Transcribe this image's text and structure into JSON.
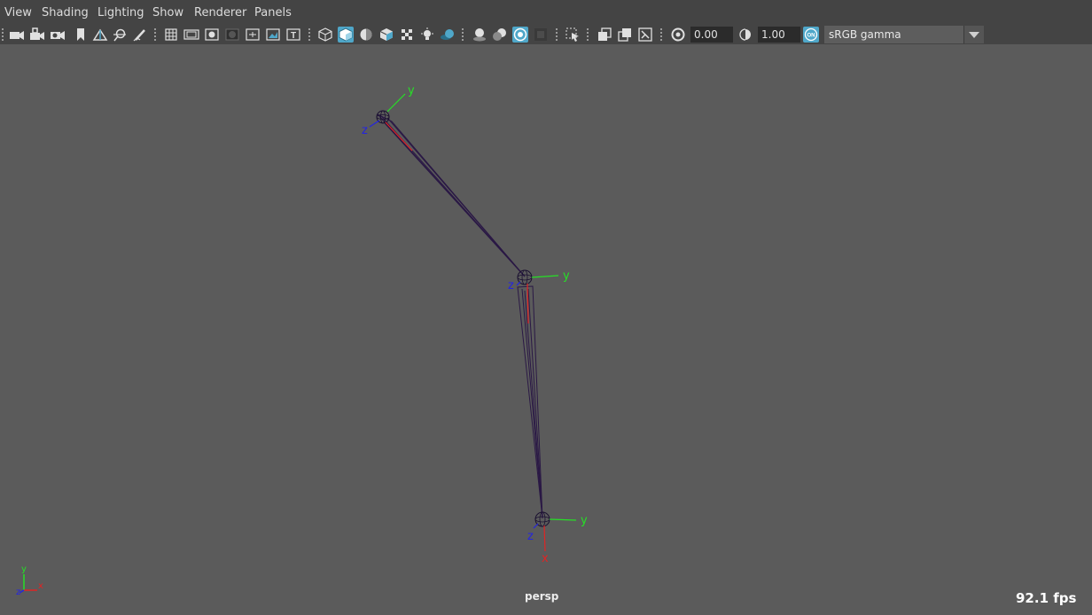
{
  "menu": {
    "view": "View",
    "shading": "Shading",
    "lighting": "Lighting",
    "show": "Show",
    "renderer": "Renderer",
    "panels": "Panels"
  },
  "toolbar": {
    "exposure_value": "0.00",
    "gamma_value": "1.00",
    "color_space": "sRGB gamma",
    "accent_color": "#4fa7c9"
  },
  "viewport": {
    "camera": "persp",
    "fps": "92.1 fps",
    "background_color": "#5b5b5b"
  },
  "axes": {
    "x": "x",
    "y": "y",
    "z": "z"
  }
}
